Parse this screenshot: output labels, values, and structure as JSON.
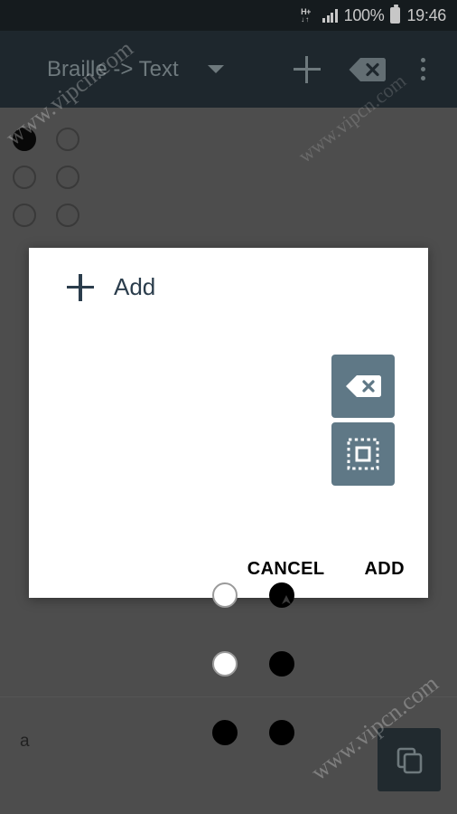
{
  "status_bar": {
    "network_type": "H+",
    "network_arrows": "↓↑",
    "battery_percent": "100%",
    "clock": "19:46",
    "signal_icon": "signal-bars-icon",
    "battery_icon": "battery-full-icon"
  },
  "toolbar": {
    "title": "Braille -> Text",
    "spinner_icon": "chevron-down-icon",
    "add_icon": "plus-icon",
    "backspace_icon": "backspace-icon",
    "overflow_icon": "more-vertical-icon",
    "background_color": "#27333a",
    "text_color": "#8e9ba1"
  },
  "content": {
    "background_braille": {
      "label": "braille-input-cell",
      "dots": [
        {
          "position": 1,
          "filled": true
        },
        {
          "position": 4,
          "filled": false
        },
        {
          "position": 2,
          "filled": false
        },
        {
          "position": 5,
          "filled": false
        },
        {
          "position": 3,
          "filled": false
        },
        {
          "position": 6,
          "filled": false
        }
      ]
    },
    "output_text": "a",
    "copy_button_icon": "copy-icon",
    "scrim_color": "#636363"
  },
  "dialog": {
    "title": "Add",
    "title_icon": "plus-icon",
    "braille": {
      "label": "dialog-braille-cell",
      "dots": [
        {
          "position": 1,
          "filled": false
        },
        {
          "position": 4,
          "filled": true
        },
        {
          "position": 2,
          "filled": false
        },
        {
          "position": 5,
          "filled": true
        },
        {
          "position": 3,
          "filled": true
        },
        {
          "position": 6,
          "filled": true
        }
      ]
    },
    "side_buttons": [
      {
        "name": "backspace",
        "icon": "backspace-icon"
      },
      {
        "name": "clear-all",
        "icon": "dashed-square-icon"
      }
    ],
    "cancel_label": "CANCEL",
    "add_label": "ADD",
    "surface_color": "#ffffff",
    "accent_color": "#5f7886",
    "title_color": "#2b3d4c"
  },
  "watermarks": {
    "text": "www.vipcn.com"
  }
}
